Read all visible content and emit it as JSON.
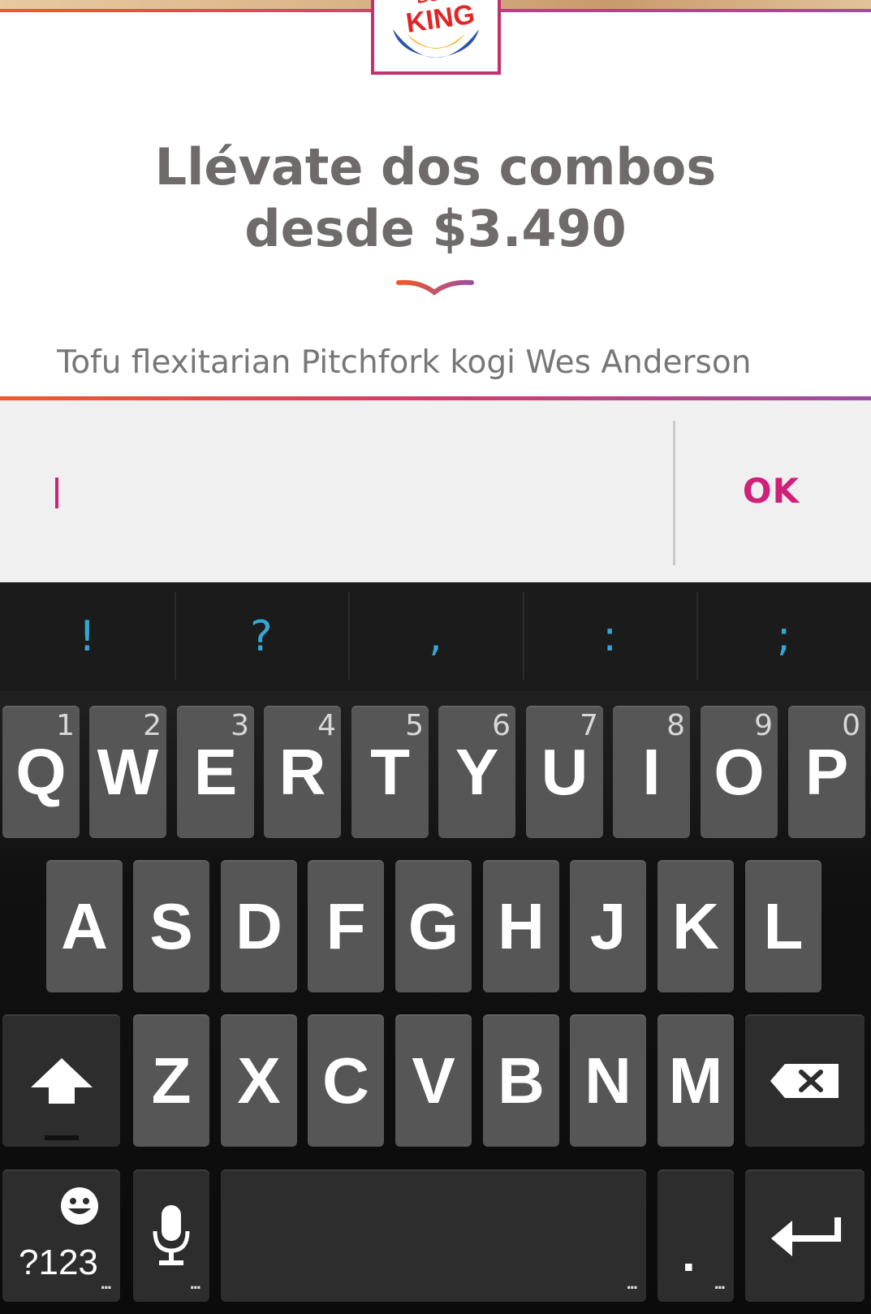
{
  "brand": {
    "logo_text_top": "BURGER",
    "logo_text_main": "KING"
  },
  "promo": {
    "headline_line1": "Llévate dos combos",
    "headline_line2": "desde $3.490",
    "description": "Tofu flexitarian Pitchfork kogi Wes Anderson"
  },
  "input": {
    "value": "",
    "ok_label": "OK"
  },
  "keyboard": {
    "suggestions": [
      "!",
      "?",
      ",",
      ":",
      ";"
    ],
    "row1": [
      {
        "label": "Q",
        "num": "1"
      },
      {
        "label": "W",
        "num": "2"
      },
      {
        "label": "E",
        "num": "3"
      },
      {
        "label": "R",
        "num": "4"
      },
      {
        "label": "T",
        "num": "5"
      },
      {
        "label": "Y",
        "num": "6"
      },
      {
        "label": "U",
        "num": "7"
      },
      {
        "label": "I",
        "num": "8"
      },
      {
        "label": "O",
        "num": "9"
      },
      {
        "label": "P",
        "num": "0"
      }
    ],
    "row2": [
      "A",
      "S",
      "D",
      "F",
      "G",
      "H",
      "J",
      "K",
      "L"
    ],
    "row3": [
      "Z",
      "X",
      "C",
      "V",
      "B",
      "N",
      "M"
    ],
    "symbols_label": "?123",
    "period_label": ".",
    "icons": {
      "shift": "shift-arrow-icon",
      "backspace": "backspace-icon",
      "emoji": "smiley-icon",
      "mic": "microphone-icon",
      "enter": "enter-arrow-icon"
    }
  },
  "colors": {
    "accent": "#d0217a",
    "gradient_start": "#f05a28",
    "gradient_end": "#9b4fa0",
    "suggestion": "#33a7d6",
    "headline": "#6f6b6b"
  }
}
